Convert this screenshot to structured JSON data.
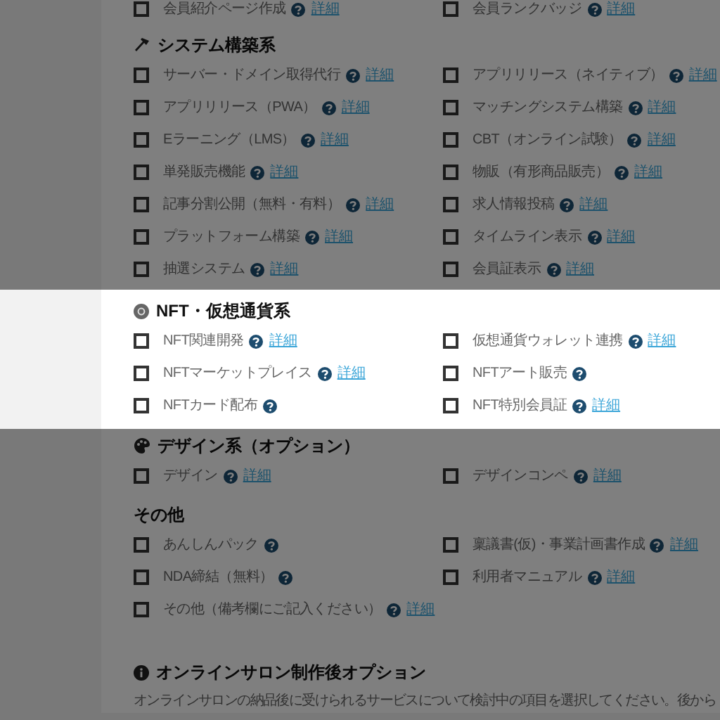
{
  "sections": [
    {
      "spotlight": false,
      "items": [
        {
          "label": "会員紹介ページ作成",
          "checked": false,
          "link": "詳細"
        },
        {
          "label": "会員ランクバッジ",
          "checked": false,
          "link": "詳細"
        }
      ]
    },
    {
      "spotlight": false,
      "kind": "hammer",
      "title": "システム構築系",
      "items": [
        {
          "label": "サーバー・ドメイン取得代行",
          "checked": false,
          "link": "詳細"
        },
        {
          "label": "アプリリリース（ネイティブ）",
          "checked": false,
          "link": "詳細"
        },
        {
          "label": "アプリリリース（PWA）",
          "checked": false,
          "link": "詳細"
        },
        {
          "label": "マッチングシステム構築",
          "checked": false,
          "link": "詳細"
        },
        {
          "label": "Eラーニング（LMS）",
          "checked": false,
          "link": "詳細"
        },
        {
          "label": "CBT（オンライン試験）",
          "checked": false,
          "link": "詳細"
        },
        {
          "label": "単発販売機能",
          "checked": false,
          "link": "詳細"
        },
        {
          "label": "物販（有形商品販売）",
          "checked": false,
          "link": "詳細"
        },
        {
          "label": "記事分割公開（無料・有料）",
          "checked": false,
          "link": "詳細"
        },
        {
          "label": "求人情報投稿",
          "checked": false,
          "link": "詳細"
        },
        {
          "label": "プラットフォーム構築",
          "checked": false,
          "link": "詳細"
        },
        {
          "label": "タイムライン表示",
          "checked": false,
          "link": "詳細"
        },
        {
          "label": "抽選システム",
          "checked": false,
          "link": "詳細"
        },
        {
          "label": "会員証表示",
          "checked": false,
          "link": "詳細"
        }
      ]
    },
    {
      "spotlight": true,
      "kind": "coin",
      "title": "NFT・仮想通貨系",
      "items": [
        {
          "label": "NFT関連開発",
          "checked": false,
          "link": "詳細"
        },
        {
          "label": "仮想通貨ウォレット連携",
          "checked": false,
          "link": "詳細"
        },
        {
          "label": "NFTマーケットプレイス",
          "checked": false,
          "link": "詳細"
        },
        {
          "label": "NFTアート販売",
          "checked": false
        },
        {
          "label": "NFTカード配布",
          "checked": false
        },
        {
          "label": "NFT特別会員証",
          "checked": false,
          "link": "詳細"
        }
      ]
    },
    {
      "spotlight": false,
      "kind": "palette",
      "title": "デザイン系（オプション）",
      "items": [
        {
          "label": "デザイン",
          "checked": false,
          "link": "詳細"
        },
        {
          "label": "デザインコンペ",
          "checked": false,
          "link": "詳細"
        }
      ]
    },
    {
      "spotlight": false,
      "title": "その他",
      "items": [
        {
          "label": "あんしんパック",
          "checked": false
        },
        {
          "label": "稟議書(仮)・事業計画書作成",
          "checked": false,
          "link": "詳細"
        },
        {
          "label": "NDA締結（無料）",
          "checked": false
        },
        {
          "label": "利用者マニュアル",
          "checked": false,
          "link": "詳細"
        },
        {
          "label": "その他（備考欄にご記入ください）",
          "checked": false,
          "link": "詳細"
        }
      ]
    },
    {
      "spotlight": false,
      "kind": "info",
      "title": "オンラインサロン制作後オプション",
      "description": "オンラインサロンの納品後に受けられるサービスについて検討中の項目を選択してください。後から"
    }
  ]
}
